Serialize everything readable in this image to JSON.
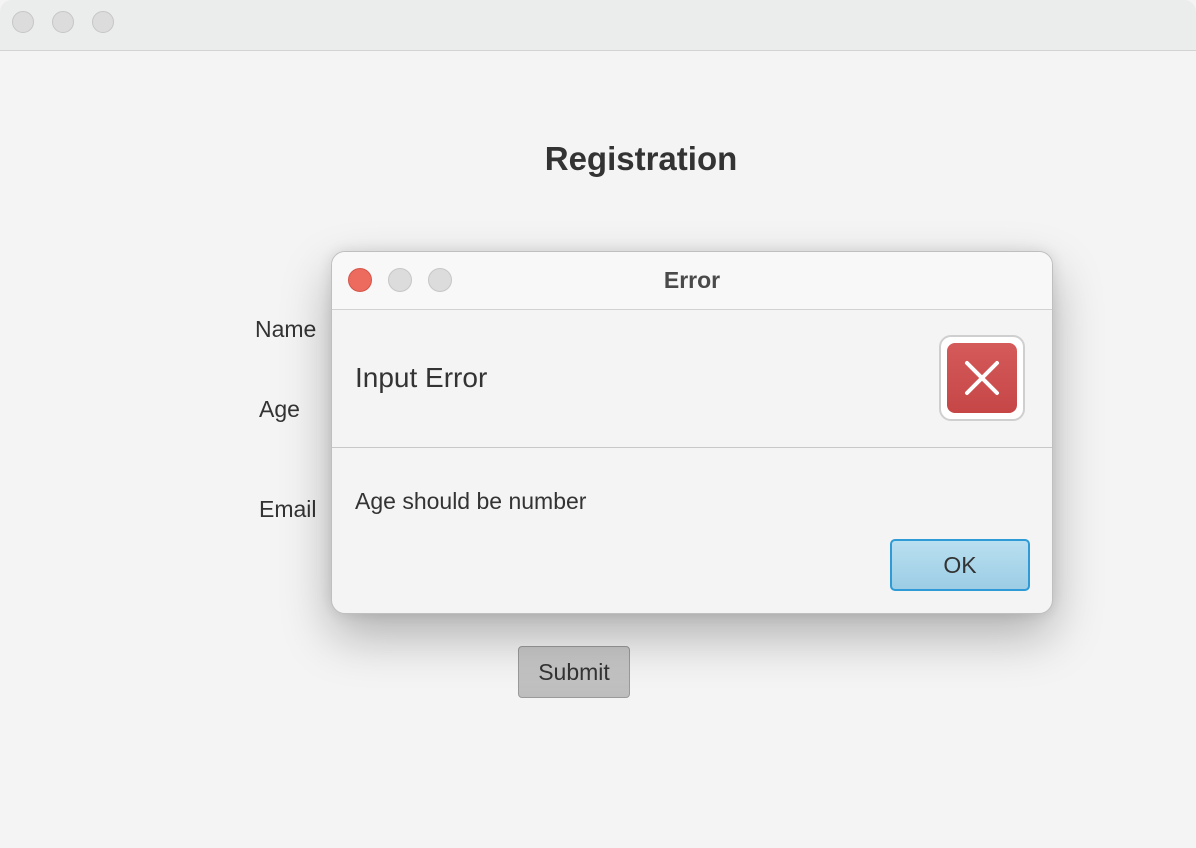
{
  "main_window": {
    "title": "Registration",
    "form": {
      "name_label": "Name",
      "age_label": "Age",
      "email_label": "Email"
    },
    "submit_label": "Submit"
  },
  "dialog": {
    "title": "Error",
    "header_text": "Input Error",
    "content_text": "Age should be number",
    "ok_label": "OK",
    "icon": "error-x-icon"
  },
  "colors": {
    "close_button": "#ec6a5e",
    "error_icon": "#c94d4d",
    "default_button_border": "#2e9bd6",
    "default_button_fill": "#a9d6ea"
  }
}
